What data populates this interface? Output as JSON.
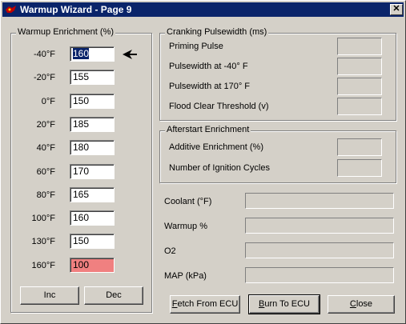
{
  "window": {
    "title": "Warmup Wizard - Page 9",
    "close_glyph": "✕"
  },
  "warmup": {
    "group_label": "Warmup Enrichment (%)",
    "rows": [
      {
        "temp": "-40°F",
        "value": "160"
      },
      {
        "temp": "-20°F",
        "value": "155"
      },
      {
        "temp": "0°F",
        "value": "150"
      },
      {
        "temp": "20°F",
        "value": "185"
      },
      {
        "temp": "40°F",
        "value": "180"
      },
      {
        "temp": "60°F",
        "value": "170"
      },
      {
        "temp": "80°F",
        "value": "165"
      },
      {
        "temp": "100°F",
        "value": "160"
      },
      {
        "temp": "130°F",
        "value": "150"
      },
      {
        "temp": "160°F",
        "value": "100"
      }
    ],
    "highlight_color": "#f08080",
    "inc_label": "Inc",
    "dec_label": "Dec"
  },
  "cranking": {
    "group_label": "Cranking Pulsewidth (ms)",
    "fields": [
      {
        "label": "Priming Pulse",
        "value": ""
      },
      {
        "label": "Pulsewidth at -40° F",
        "value": ""
      },
      {
        "label": "Pulsewidth at  170° F",
        "value": ""
      },
      {
        "label": "Flood Clear Threshold (v)",
        "value": ""
      }
    ]
  },
  "afterstart": {
    "group_label": "Afterstart Enrichment",
    "fields": [
      {
        "label": "Additive Enrichment (%)",
        "value": ""
      },
      {
        "label": "Number of Ignition Cycles",
        "value": ""
      }
    ]
  },
  "gauges": [
    {
      "label": "Coolant (°F)",
      "value": ""
    },
    {
      "label": "Warmup %",
      "value": ""
    },
    {
      "label": "O2",
      "value": ""
    },
    {
      "label": "MAP (kPa)",
      "value": ""
    }
  ],
  "buttons": {
    "fetch": {
      "u": "F",
      "rest": "etch From ECU"
    },
    "burn": {
      "u": "B",
      "rest": "urn To ECU"
    },
    "close": {
      "u": "C",
      "rest": "lose"
    }
  }
}
